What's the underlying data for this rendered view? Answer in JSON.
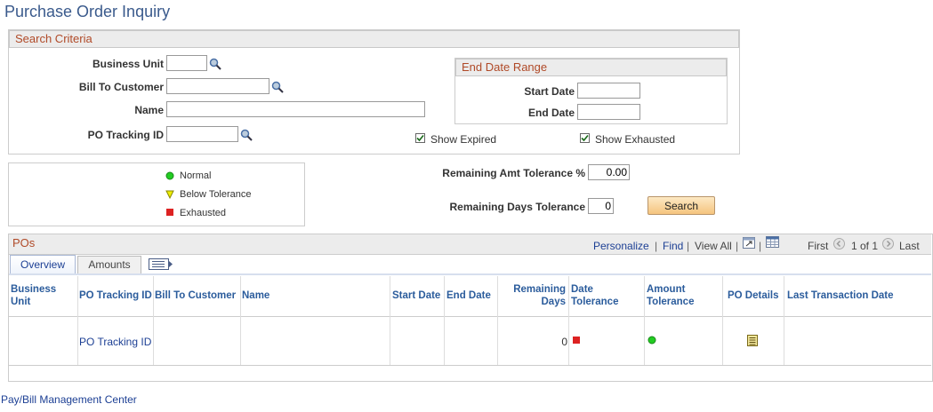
{
  "page_title": "Purchase Order Inquiry",
  "search_criteria": {
    "header": "Search Criteria",
    "business_unit_label": "Business Unit",
    "business_unit_value": "",
    "bill_to_customer_label": "Bill To Customer",
    "bill_to_customer_value": "",
    "name_label": "Name",
    "name_value": "",
    "po_tracking_id_label": "PO Tracking ID",
    "po_tracking_id_value": "",
    "end_date_range": {
      "header": "End Date Range",
      "start_date_label": "Start Date",
      "start_date_value": "",
      "end_date_label": "End Date",
      "end_date_value": ""
    },
    "show_expired_label": "Show Expired",
    "show_expired_checked": true,
    "show_exhausted_label": "Show Exhausted",
    "show_exhausted_checked": true
  },
  "legend": {
    "normal": "Normal",
    "below_tolerance": "Below Tolerance",
    "exhausted": "Exhausted",
    "normal_color": "#22cc22",
    "below_color": "#eeee00",
    "exhausted_color": "#dd2222"
  },
  "tolerance": {
    "remaining_amt_label": "Remaining Amt Tolerance %",
    "remaining_amt_value": "0.00",
    "remaining_days_label": "Remaining Days Tolerance",
    "remaining_days_value": "0",
    "search_button": "Search"
  },
  "pos_grid": {
    "header": "POs",
    "personalize": "Personalize",
    "find": "Find",
    "view_all": "View All",
    "first": "First",
    "page_status": "1 of 1",
    "last": "Last",
    "tabs": [
      "Overview",
      "Amounts"
    ],
    "columns": {
      "business_unit_line1": "Business",
      "business_unit_line2": "Unit",
      "po_tracking_id": "PO Tracking ID",
      "bill_to_customer": "Bill To Customer",
      "name": "Name",
      "start_date": "Start Date",
      "end_date": "End Date",
      "remaining_days_line1": "Remaining",
      "remaining_days_line2": "Days",
      "date_tolerance_line1": "Date",
      "date_tolerance_line2": "Tolerance",
      "amount_tolerance_line1": "Amount",
      "amount_tolerance_line2": "Tolerance",
      "po_details": "PO Details",
      "last_transaction_date": "Last Transaction Date"
    },
    "row": {
      "business_unit": "",
      "po_tracking_id": "PO Tracking ID",
      "bill_to_customer": "",
      "name": "",
      "start_date": "",
      "end_date": "",
      "remaining_days": "0",
      "date_tolerance_status": "exhausted",
      "amount_tolerance_status": "normal",
      "last_transaction_date": ""
    }
  },
  "footer_link": "Pay/Bill Management Center"
}
